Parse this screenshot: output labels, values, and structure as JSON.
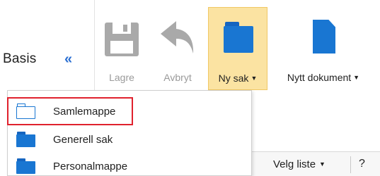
{
  "left_pane": {
    "title": "Basis",
    "collapse_label": "«"
  },
  "ribbon": {
    "save_label": "Lagre",
    "cancel_label": "Avbryt",
    "new_case_label": "Ny sak",
    "new_document_label": "Nytt dokument"
  },
  "dropdown": {
    "items": [
      {
        "label": "Samlemappe",
        "icon": "folder-outline-icon"
      },
      {
        "label": "Generell sak",
        "icon": "folder-icon"
      },
      {
        "label": "Personalmappe",
        "icon": "folder-icon"
      }
    ]
  },
  "bottom_bar": {
    "select_list_label": "Velg liste",
    "help_label": "?"
  },
  "colors": {
    "accent": "#1976d2",
    "selected_button_bg": "#fbe3a2",
    "highlight_border": "#e0212d",
    "disabled_icon": "#a9a9a9"
  }
}
